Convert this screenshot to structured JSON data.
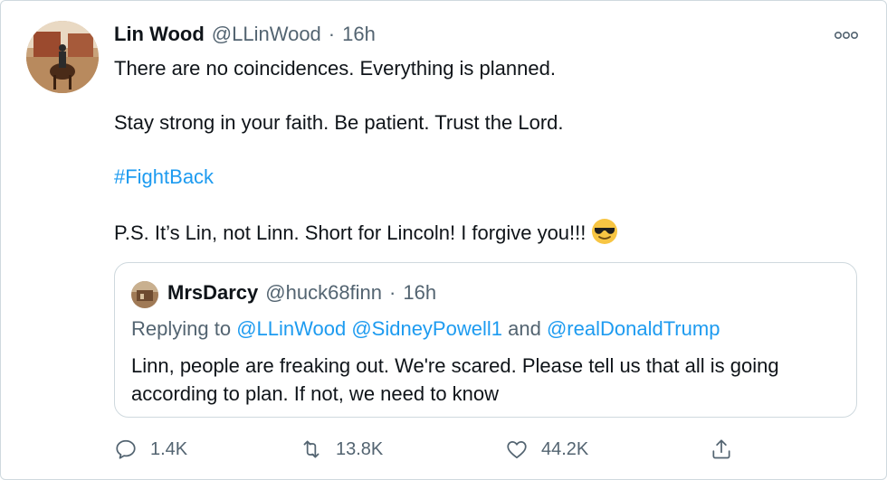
{
  "tweet": {
    "author_name": "Lin Wood",
    "author_handle": "@LLinWood",
    "separator": "·",
    "time": "16h",
    "lines": [
      "There are no coincidences. Everything is planned.",
      "Stay strong in your faith. Be patient. Trust the Lord.",
      "#FightBack",
      "P.S. It’s Lin, not Linn. Short for Lincoln! I forgive you!!!"
    ],
    "emoji": "smiling-face-with-sunglasses"
  },
  "quoted_tweet": {
    "author_name": "MrsDarcy",
    "author_handle": "@huck68finn",
    "separator": "·",
    "time": "16h",
    "reply_prefix": "Replying to",
    "reply_mention_1": "@LLinWood",
    "reply_mention_2": "@SidneyPowell1",
    "reply_and": "and",
    "reply_mention_3": "@realDonaldTrump",
    "text": "Linn, people are freaking out. We're scared. Please tell us that all is going according to plan. If not, we need to know"
  },
  "actions": {
    "reply_count": "1.4K",
    "retweet_count": "13.8K",
    "like_count": "44.2K"
  },
  "colors": {
    "link": "#1d9bf0",
    "secondary_text": "#536471",
    "border": "#cfd9de"
  },
  "icons": [
    "more-icon",
    "reply-icon",
    "retweet-icon",
    "like-icon",
    "share-icon"
  ]
}
